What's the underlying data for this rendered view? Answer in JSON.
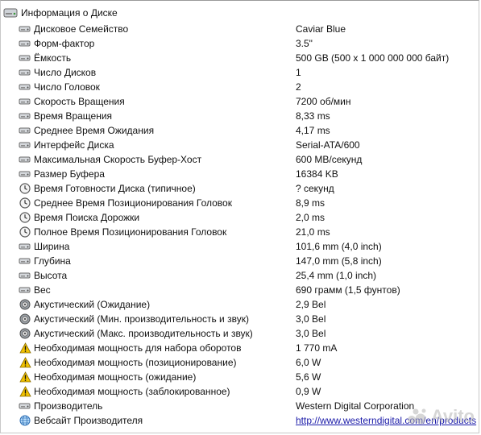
{
  "section": {
    "title": "Информация о Диске",
    "icon": "hdd-icon"
  },
  "rows": [
    {
      "label": "Дисковое Семейство",
      "value": "Caviar Blue",
      "icon": "disk-property-icon"
    },
    {
      "label": "Форм-фактор",
      "value": "3.5\"",
      "icon": "disk-property-icon"
    },
    {
      "label": "Ёмкость",
      "value": "500 GB (500 x 1 000 000 000 байт)",
      "icon": "disk-property-icon"
    },
    {
      "label": "Число Дисков",
      "value": "1",
      "icon": "disk-property-icon"
    },
    {
      "label": "Число Головок",
      "value": "2",
      "icon": "disk-property-icon"
    },
    {
      "label": "Скорость Вращения",
      "value": "7200 об/мин",
      "icon": "disk-property-icon"
    },
    {
      "label": "Время Вращения",
      "value": "8,33 ms",
      "icon": "disk-property-icon"
    },
    {
      "label": "Среднее Время Ожидания",
      "value": "4,17 ms",
      "icon": "disk-property-icon"
    },
    {
      "label": "Интерфейс Диска",
      "value": "Serial-ATA/600",
      "icon": "disk-property-icon"
    },
    {
      "label": "Максимальная Скорость Буфер-Хост",
      "value": "600 MB/секунд",
      "icon": "disk-property-icon"
    },
    {
      "label": "Размер Буфера",
      "value": "16384 KB",
      "icon": "disk-property-icon"
    },
    {
      "label": "Время Готовности Диска (типичное)",
      "value": "? секунд",
      "icon": "clock-icon"
    },
    {
      "label": "Среднее Время Позиционирования Головок",
      "value": "8,9 ms",
      "icon": "clock-icon"
    },
    {
      "label": "Время Поиска Дорожки",
      "value": "2,0 ms",
      "icon": "clock-icon"
    },
    {
      "label": "Полное Время Позиционирования Головок",
      "value": "21,0 ms",
      "icon": "clock-icon"
    },
    {
      "label": "Ширина",
      "value": "101,6 mm (4,0 inch)",
      "icon": "disk-property-icon"
    },
    {
      "label": "Глубина",
      "value": "147,0 mm (5,8 inch)",
      "icon": "disk-property-icon"
    },
    {
      "label": "Высота",
      "value": "25,4 mm (1,0 inch)",
      "icon": "disk-property-icon"
    },
    {
      "label": "Вес",
      "value": "690 грамм (1,5 фунтов)",
      "icon": "disk-property-icon"
    },
    {
      "label": "Акустический (Ожидание)",
      "value": "2,9 Bel",
      "icon": "speaker-icon"
    },
    {
      "label": "Акустический (Мин. производительность и звук)",
      "value": "3,0 Bel",
      "icon": "speaker-icon"
    },
    {
      "label": "Акустический (Макс. производительность и звук)",
      "value": "3,0 Bel",
      "icon": "speaker-icon"
    },
    {
      "label": "Необходимая мощность для набора оборотов",
      "value": "1 770 mA",
      "icon": "warning-icon"
    },
    {
      "label": "Необходимая мощность (позиционирование)",
      "value": "6,0 W",
      "icon": "warning-icon"
    },
    {
      "label": "Необходимая мощность (ожидание)",
      "value": "5,6 W",
      "icon": "warning-icon"
    },
    {
      "label": "Необходимая мощность (заблокированное)",
      "value": "0,9 W",
      "icon": "warning-icon"
    },
    {
      "label": "Производитель",
      "value": "Western Digital Corporation",
      "icon": "disk-property-icon"
    },
    {
      "label": "Вебсайт Производителя",
      "value": "http://www.westerndigital.com/en/products",
      "icon": "globe-icon",
      "link": true
    }
  ],
  "watermark": {
    "text": "Avito",
    "icon": "avito-logo-icon"
  },
  "colors": {
    "link": "#1a1aa8",
    "warning": "#f2c200",
    "text": "#111111"
  }
}
